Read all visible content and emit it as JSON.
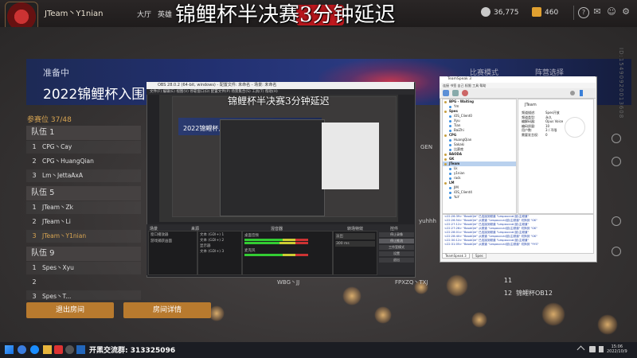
{
  "header": {
    "team_name": "JTeam丶Y1nian",
    "nav": [
      "大厅",
      "英雄"
    ],
    "overlay_title": "锦鲤杯半决赛3分钟延迟",
    "coins": "36,775",
    "gems": "460"
  },
  "room": {
    "status": "准备中",
    "title": "2022锦鲤杯入围",
    "mode_label": "比赛模式",
    "side_label": "阵营选择",
    "vertical_id": "ID:15490920013608",
    "participants": "参赛位 37/48"
  },
  "teams": [
    {
      "name": "队伍 1",
      "members": [
        "CPG丶Cay",
        "CPG丶HuangQian",
        "Lm丶JettaAxA"
      ]
    },
    {
      "name": "队伍 5",
      "members": [
        "JTeam丶Zk",
        "JTeam丶Li",
        "JTeam丶Y1nian"
      ]
    },
    {
      "name": "队伍 9",
      "members": [
        "Spes丶Xyu",
        "",
        "Spes丶T..."
      ]
    }
  ],
  "slot_numbers": [
    "1",
    "2",
    "3"
  ],
  "right_slots": {
    "gen": "GEN",
    "yuhhh": "yuhhh",
    "slot11": "11",
    "slot12": "12",
    "slot12_name": "锦鲤杯OB12",
    "mid1": "FPXZQ丶TXJ",
    "mid2": "WBG丶JJ"
  },
  "buttons": {
    "leave": "退出房间",
    "details": "房间详情"
  },
  "obs": {
    "title": "OBS 28.0.2 (64-bit, windows) - 配置文件: 未命名 - 场景: 未命名",
    "menu": "文件(F)  编辑(E)  视图(V)  停靠窗口(D)  配置文件(P)  场景集合(S)  工具(T)  帮助(H)",
    "inner_title": "锦鲤杯半决赛3分钟延迟",
    "nested_title": "2022锦鲤杯入围",
    "scenes_header": "场景",
    "sources_header": "来源",
    "mixer_header": "混音器",
    "transitions_header": "转场特效",
    "controls_header": "控件",
    "scene_items": [
      "窗口播放器",
      "游戏捕获画面"
    ],
    "source_items": [
      "文本 (GDI+) 1",
      "文本 (GDI+) 2",
      "显示器",
      "文本 (GDI+) 3"
    ],
    "mixer_items": [
      "桌面音频",
      "麦克风"
    ],
    "fade_label": "淡出",
    "duration": "300 ms",
    "controls": [
      "停止录像",
      "停止推流",
      "工作室模式",
      "设置",
      "退出"
    ]
  },
  "ts": {
    "title": "TeamSpeak 3",
    "menu": "连接  书签  自己  权限  工具  帮助",
    "tree": [
      {
        "text": "BPG - Waiting",
        "ch": true
      },
      {
        "text": "Ym",
        "ch": false
      },
      {
        "text": "Spes",
        "ch": true
      },
      {
        "text": "iOS_Client0",
        "ch": false
      },
      {
        "text": "Xyu",
        "ch": false
      },
      {
        "text": "Tian",
        "ch": false
      },
      {
        "text": "BaiZhi",
        "ch": false
      },
      {
        "text": "CPG",
        "ch": true
      },
      {
        "text": "HuangQian",
        "ch": false
      },
      {
        "text": "Sakaki",
        "ch": false
      },
      {
        "text": "比赛席",
        "ch": false
      },
      {
        "text": "BAODA",
        "ch": true
      },
      {
        "text": "GK",
        "ch": true
      },
      {
        "text": "JTeam",
        "ch": true,
        "sel": true
      },
      {
        "text": "Lk",
        "ch": false
      },
      {
        "text": "y1nian",
        "ch": false
      },
      {
        "text": "rack",
        "ch": false
      },
      {
        "text": "LM",
        "ch": true
      },
      {
        "text": "JIM",
        "ch": false
      },
      {
        "text": "iOS_Client4",
        "ch": false
      },
      {
        "text": "YuY",
        "ch": false
      }
    ],
    "info_name": "JTeam",
    "info_lines": [
      "频道描述:",
      "频道类型:",
      "编解码器:",
      "编码质量:",
      "用户数:",
      "需要发言权:"
    ],
    "info_values": [
      "Spes开放",
      "永久",
      "Opus Voice",
      "10",
      "3 / 不限",
      "0"
    ],
    "log": [
      "<22:26:39> \"BaoAQie\" 已连接到频道 \"Lespauccai(锁)主频道\"",
      "<22:26:54> \"BaoAQie\" 从频道 \"Lespauccai(锁)主频道\" 切换到 \"GK\"",
      "<22:27:12> \"BaoAQie\" 已连接到频道 \"Lespauccai(锁)主频道\"",
      "<22:27:26> \"BaoAQie\" 从频道 \"Lespauccai(锁)主频道\" 切换到 \"GK\"",
      "<22:28:01> \"BaoAQie\" 已连接到频道 \"Lespauccai(锁)主频道\"",
      "<22:28:40> \"BaoAQie\" 从频道 \"Lespauccai(锁)主频道\" 切换到 \"GK\"",
      "<22:30:12> \"BaoAQie\" 已连接到频道 \"Lespauccai(锁)主频道\"",
      "<22:31:05> \"BaoAQie\" 从频道 \"Lespauccai(锁)主频道\" 切换到 \"YYS\""
    ],
    "tabs": [
      "TeamSpeak 3",
      "Spes"
    ]
  },
  "taskbar": {
    "promo": "开黑交流群: 313325096",
    "clock": [
      "15:06",
      "2022/10/9"
    ]
  },
  "colors": {
    "accent_gold": "#d8a552",
    "button_orange": "#b87a2e",
    "banner_blue": "#223070",
    "title_red": "#c0181e"
  }
}
